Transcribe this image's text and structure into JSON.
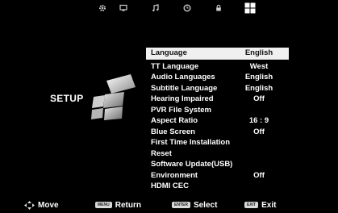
{
  "top_tabs": [
    {
      "name": "gear-icon",
      "label": "Picture"
    },
    {
      "name": "monitor-icon",
      "label": "Channel"
    },
    {
      "name": "music-note-icon",
      "label": "Sound"
    },
    {
      "name": "clock-icon",
      "label": "Time"
    },
    {
      "name": "lock-icon",
      "label": "Lock"
    },
    {
      "name": "setup-grid-icon",
      "label": "Setup"
    }
  ],
  "section_title": "SETUP",
  "menu": [
    {
      "label": "Language",
      "value": "English"
    },
    {
      "label": "TT Language",
      "value": "West"
    },
    {
      "label": "Audio Languages",
      "value": "English"
    },
    {
      "label": "Subtitle Language",
      "value": "English"
    },
    {
      "label": "Hearing Impaired",
      "value": "Off"
    },
    {
      "label": "PVR File System",
      "value": ""
    },
    {
      "label": "Aspect Ratio",
      "value": "16 : 9"
    },
    {
      "label": "Blue Screen",
      "value": "Off"
    },
    {
      "label": "First Time Installation",
      "value": ""
    },
    {
      "label": "Reset",
      "value": ""
    },
    {
      "label": "Software Update(USB)",
      "value": ""
    },
    {
      "label": "Environment",
      "value": "Off"
    },
    {
      "label": "HDMI CEC",
      "value": ""
    }
  ],
  "footer": {
    "move_label": "Move",
    "menu_key": "MENU",
    "return_label": "Return",
    "enter_key": "ENTER",
    "select_label": "Select",
    "exit_key": "EXIT",
    "exit_label": "Exit"
  },
  "colors": {
    "background": "#000000",
    "selected_row": "#f0f0f0",
    "text": "#ffffff"
  }
}
